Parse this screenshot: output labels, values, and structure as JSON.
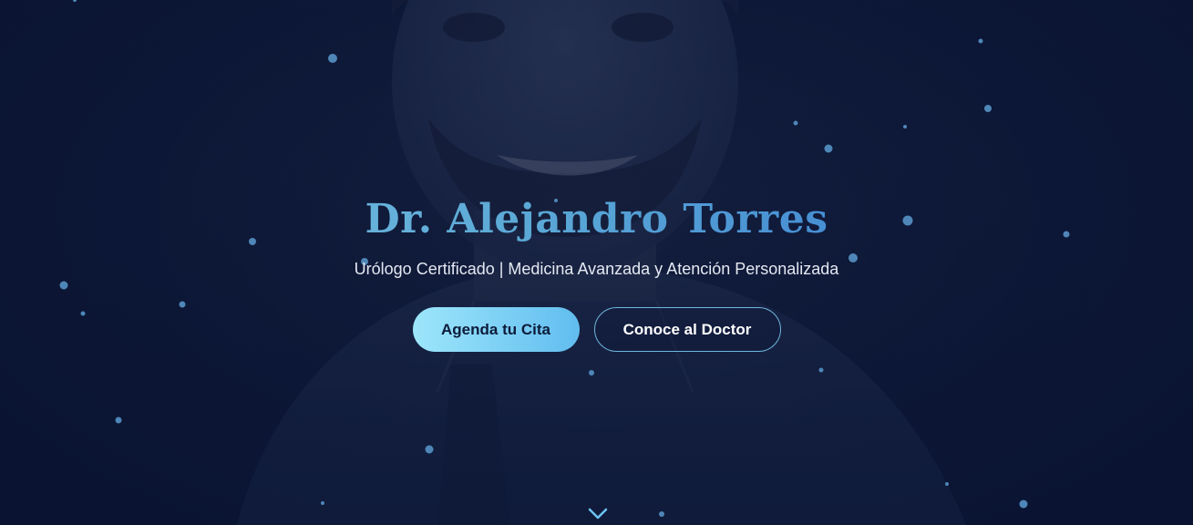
{
  "hero": {
    "title": "Dr. Alejandro Torres",
    "subtitle": "Urólogo Certificado | Medicina Avanzada y Atención Personalizada",
    "primary_button": "Agenda tu Cita",
    "secondary_button": "Conoce al Doctor",
    "scroll_icon": "chevron-down-icon",
    "background_image": "doctor-portrait"
  },
  "colors": {
    "background": "#0b1535",
    "title_gradient_start": "#7fc7e4",
    "title_gradient_end": "#2f6fd1",
    "primary_button_start": "#9de6fb",
    "primary_button_end": "#61bdef",
    "accent": "#5aa8d6",
    "particle": "#4f86b8"
  }
}
